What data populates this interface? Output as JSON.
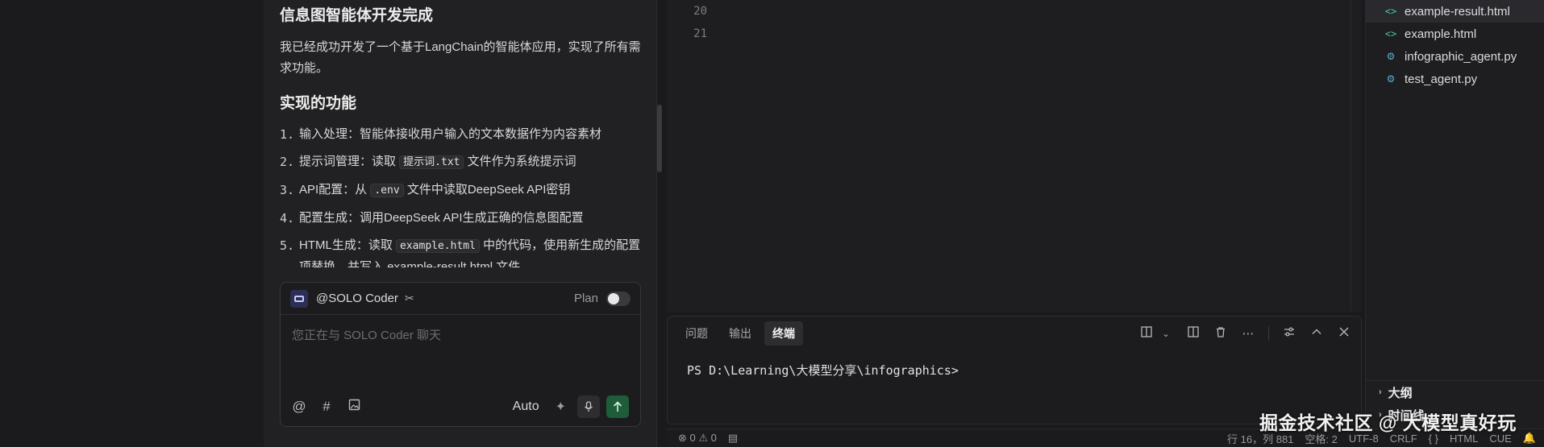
{
  "chat": {
    "heading": "信息图智能体开发完成",
    "intro": "我已经成功开发了一个基于LangChain的智能体应用，实现了所有需求功能。",
    "features_heading": "实现的功能",
    "items": [
      {
        "num": "1.",
        "pre": "输入处理：智能体接收用户输入的文本数据作为内容素材",
        "code": "",
        "post": ""
      },
      {
        "num": "2.",
        "pre": "提示词管理：读取 ",
        "code": "提示词.txt",
        "post": " 文件作为系统提示词"
      },
      {
        "num": "3.",
        "pre": "API配置：从 ",
        "code": ".env",
        "post": " 文件中读取DeepSeek API密钥"
      },
      {
        "num": "4.",
        "pre": "配置生成：调用DeepSeek API生成正确的信息图配置",
        "code": "",
        "post": ""
      },
      {
        "num": "5.",
        "pre": "HTML生成：读取 ",
        "code": "example.html",
        "post": " 中的代码，使用新生成的配置项替换，并写入 example-result.html 文件"
      }
    ]
  },
  "composer": {
    "agent": "@SOLO Coder",
    "plan_label": "Plan",
    "placeholder": "您正在与 SOLO Coder 聊天",
    "auto_label": "Auto"
  },
  "editor": {
    "line_numbers": [
      "20",
      "21"
    ]
  },
  "panel": {
    "tabs": [
      "问题",
      "输出",
      "终端"
    ],
    "active_tab": "终端",
    "terminal_line": "PS D:\\Learning\\大模型分享\\infographics>"
  },
  "explorer": {
    "files": [
      {
        "name": "example-result.html",
        "type": "html"
      },
      {
        "name": "example.html",
        "type": "html"
      },
      {
        "name": "infographic_agent.py",
        "type": "py"
      },
      {
        "name": "test_agent.py",
        "type": "py"
      }
    ],
    "sections": [
      "大纲",
      "时间线"
    ]
  },
  "status": {
    "errors": "0",
    "warnings": "0",
    "position": "行 16，列 881",
    "spaces": "空格: 2",
    "encoding": "UTF-8",
    "eol": "CRLF",
    "braces": "{ }",
    "language": "HTML",
    "cue": "CUE"
  },
  "watermark": "掘金技术社区 @ 大模型真好玩"
}
